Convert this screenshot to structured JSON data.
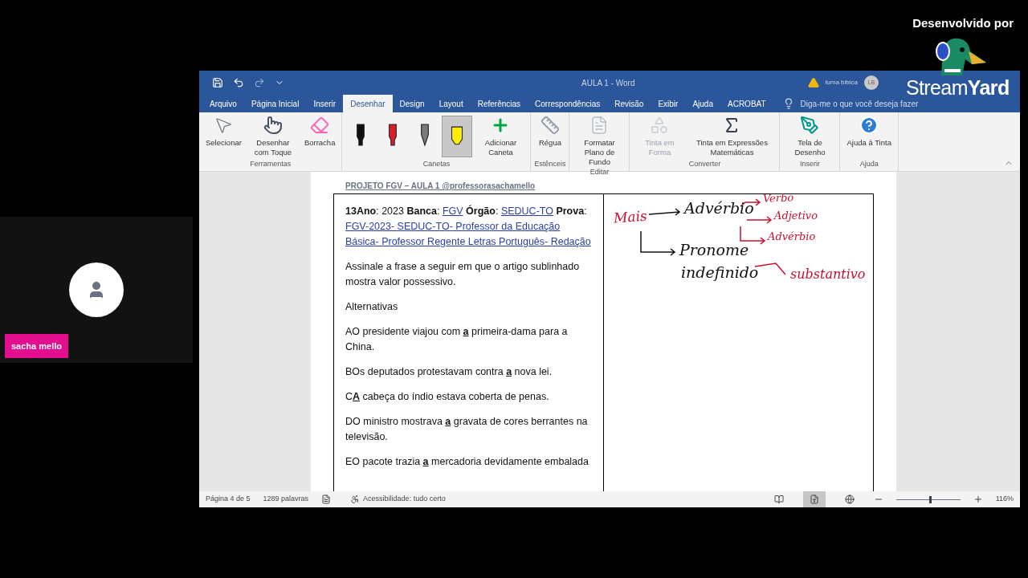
{
  "overlay": {
    "credit": "Desenvolvido por",
    "brand_light": "Stream",
    "brand_bold": "Yard"
  },
  "participant": {
    "name": "sacha mello"
  },
  "window": {
    "title": "AULA 1  -  Word",
    "user": "luma bibica",
    "user_initials": "LB",
    "warning": true
  },
  "tabs": [
    {
      "label": "Arquivo",
      "selected": false
    },
    {
      "label": "Página Inicial",
      "selected": false
    },
    {
      "label": "Inserir",
      "selected": false
    },
    {
      "label": "Desenhar",
      "selected": true
    },
    {
      "label": "Design",
      "selected": false
    },
    {
      "label": "Layout",
      "selected": false
    },
    {
      "label": "Referências",
      "selected": false
    },
    {
      "label": "Correspondências",
      "selected": false
    },
    {
      "label": "Revisão",
      "selected": false
    },
    {
      "label": "Exibir",
      "selected": false
    },
    {
      "label": "Ajuda",
      "selected": false
    },
    {
      "label": "ACROBAT",
      "selected": false
    }
  ],
  "tell_me": {
    "placeholder": "Diga-me o que você deseja fazer"
  },
  "ribbon": [
    {
      "label": "Ferramentas",
      "buttons": [
        {
          "kind": "pointer",
          "label": "Selecionar",
          "disabled": false
        },
        {
          "kind": "touch",
          "label": "Desenhar com Toque",
          "disabled": false
        },
        {
          "kind": "eraser",
          "label": "Borracha",
          "disabled": false
        }
      ]
    },
    {
      "label": "Canetas",
      "buttons": [
        {
          "kind": "pen",
          "color": "#111111",
          "selected": false
        },
        {
          "kind": "pen",
          "color": "#d91e2a",
          "selected": false
        },
        {
          "kind": "pencil",
          "color": "#7a7a7a",
          "selected": false
        },
        {
          "kind": "highlighter",
          "color": "#ffee00",
          "selected": true
        },
        {
          "kind": "add",
          "label": "Adicionar Caneta",
          "disabled": false
        }
      ]
    },
    {
      "label": "Estênceis",
      "buttons": [
        {
          "kind": "ruler",
          "label": "Régua",
          "disabled": false
        }
      ]
    },
    {
      "label": "Editar",
      "buttons": [
        {
          "kind": "page",
          "label": "Formatar Plano de Fundo",
          "disabled": false
        }
      ]
    },
    {
      "label": "Converter",
      "buttons": [
        {
          "kind": "shape",
          "label": "Tinta em Forma",
          "disabled": true
        },
        {
          "kind": "math",
          "label": "Tinta em Expressões Matemáticas",
          "disabled": false
        }
      ]
    },
    {
      "label": "Inserir",
      "buttons": [
        {
          "kind": "canvas",
          "label": "Tela de Desenho",
          "disabled": false
        }
      ]
    },
    {
      "label": "Ajuda",
      "buttons": [
        {
          "kind": "help",
          "label": "Ajuda à Tinta",
          "disabled": false
        }
      ]
    }
  ],
  "document": {
    "header": "PROJETO FGV – AULA 1 @professorasachamello",
    "question_parts": [
      {
        "kind": "bold",
        "text": "13Ano"
      },
      {
        "kind": "plain",
        "text": ": 2023 "
      },
      {
        "kind": "bold",
        "text": "Banca"
      },
      {
        "kind": "plain",
        "text": ": "
      },
      {
        "kind": "link",
        "text": "FGV"
      },
      {
        "kind": "bold",
        "text": " Órgão"
      },
      {
        "kind": "plain",
        "text": ": "
      },
      {
        "kind": "link",
        "text": "SEDUC-TO"
      },
      {
        "kind": "bold",
        "text": " Prova"
      },
      {
        "kind": "plain",
        "text": ": "
      },
      {
        "kind": "link",
        "text": "FGV-2023- SEDUC-TO- Professor da Educação Básica- Professor Regente Letras Português- Redação"
      }
    ],
    "prompt": "Assinale a frase a seguir em que o artigo sublinhado mostra valor possessivo.",
    "alternatives_label": "Alternativas",
    "alternatives": [
      {
        "letter": "A",
        "before": "O presidente viajou com ",
        "underlined": "a",
        "after": " primeira-dama para a China."
      },
      {
        "letter": "B",
        "before": "Os deputados protestavam contra ",
        "underlined": "a",
        "after": " nova lei."
      },
      {
        "letter": "C",
        "underlined": "A",
        "after": " cabeça do índio estava coberta de penas."
      },
      {
        "letter": "D",
        "before": "O ministro mostrava ",
        "underlined": "a",
        "after": " gravata de cores berrantes na televisão."
      },
      {
        "letter": "E",
        "before": "O pacote trazia ",
        "underlined": "a",
        "after": " mercadoria devidamente embalada"
      }
    ],
    "handwriting": [
      {
        "text": "Mais",
        "color": "#c8102e"
      },
      {
        "text": "Advérbio",
        "color": "#111111"
      },
      {
        "text": "Verbo",
        "color": "#c8102e"
      },
      {
        "text": "Adjetivo",
        "color": "#c8102e"
      },
      {
        "text": "Advérbio",
        "color": "#c8102e"
      },
      {
        "text": "Pronome",
        "color": "#111111"
      },
      {
        "text": "indefinido",
        "color": "#111111"
      },
      {
        "text": "substantivo",
        "color": "#c8102e"
      }
    ]
  },
  "status_bar": {
    "page": "Página 4 de 5",
    "words": "1289 palavras",
    "accessibility": "Acessibilidade: tudo certo",
    "zoom": {
      "text": "116%",
      "level": 0.52
    },
    "views": [
      {
        "kind": "read",
        "selected": false
      },
      {
        "kind": "print",
        "selected": true
      },
      {
        "kind": "web",
        "selected": false
      }
    ]
  }
}
